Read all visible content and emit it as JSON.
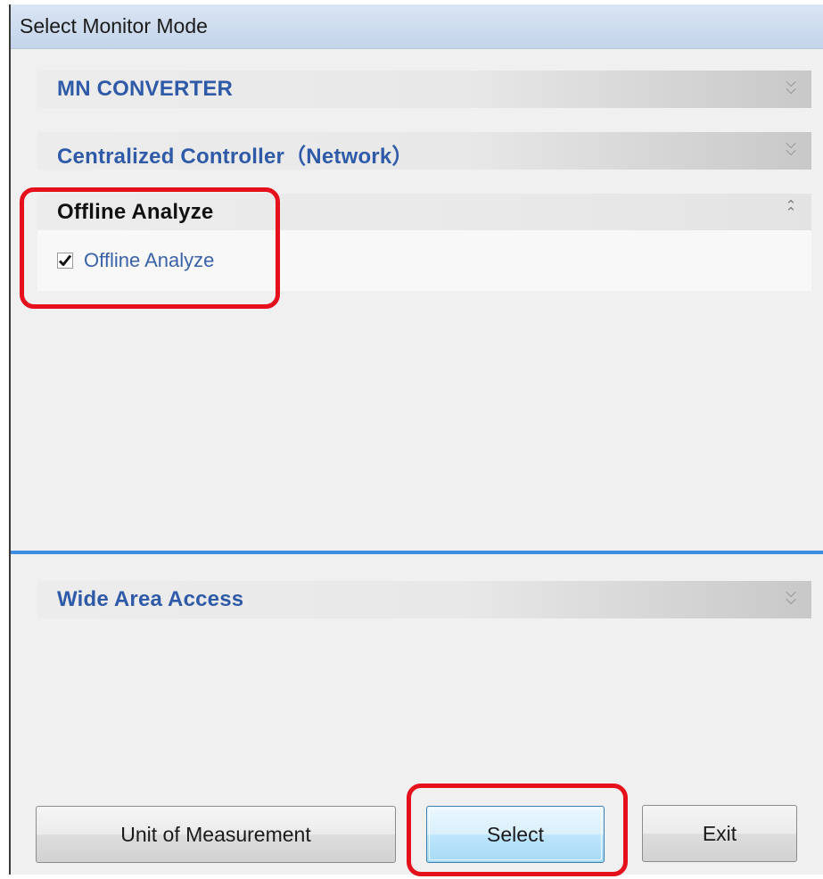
{
  "window": {
    "title": "Select Monitor Mode"
  },
  "sections": {
    "mn_converter": {
      "label": "MN CONVERTER",
      "expanded": false
    },
    "centralized_controller": {
      "label": "Centralized Controller（Network）",
      "expanded": false
    },
    "offline_analyze": {
      "label": "Offline Analyze",
      "expanded": true,
      "option": {
        "label": "Offline Analyze",
        "checked": true
      }
    },
    "wide_area_access": {
      "label": "Wide Area Access",
      "expanded": false
    }
  },
  "buttons": {
    "unit_of_measurement": "Unit of Measurement",
    "select": "Select",
    "exit": "Exit"
  },
  "icons": {
    "expand": "chevron-double-down-icon",
    "collapse": "chevron-double-up-icon",
    "check": "checkmark-icon"
  },
  "colors": {
    "section_label": "#2f5aa8",
    "divider": "#3d8ee0",
    "annotation": "#e5101c"
  }
}
